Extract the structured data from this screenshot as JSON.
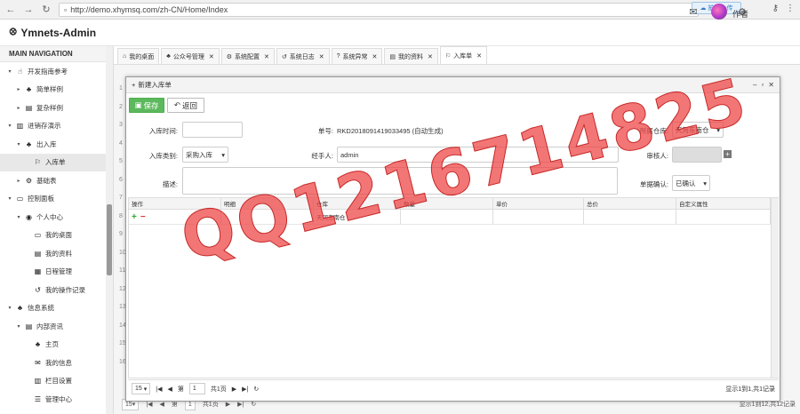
{
  "browser": {
    "url": "http://demo.xhymsq.com/zh-CN/Home/Index",
    "ext_label": "拍腾上传"
  },
  "header": {
    "app_title": "Ymnets-Admin",
    "username": "作者"
  },
  "sidebar": {
    "title": "MAIN NAVIGATION",
    "items": [
      {
        "label": "开发指南参考",
        "level": 0,
        "caret": "▾",
        "icon": "☝"
      },
      {
        "label": "简单样例",
        "level": 1,
        "caret": "▸",
        "icon": "♣"
      },
      {
        "label": "复杂样例",
        "level": 1,
        "caret": "▸",
        "icon": "▤"
      },
      {
        "label": "进销存演示",
        "level": 0,
        "caret": "▾",
        "icon": "▥"
      },
      {
        "label": "出入库",
        "level": 1,
        "caret": "▾",
        "icon": "♣"
      },
      {
        "label": "入库单",
        "level": 2,
        "caret": "",
        "icon": "⚐"
      },
      {
        "label": "基础表",
        "level": 1,
        "caret": "▸",
        "icon": "⚙"
      },
      {
        "label": "控制面板",
        "level": 0,
        "caret": "▾",
        "icon": "▭"
      },
      {
        "label": "个人中心",
        "level": 1,
        "caret": "▾",
        "icon": "◉"
      },
      {
        "label": "我的桌面",
        "level": 2,
        "caret": "",
        "icon": "▭"
      },
      {
        "label": "我的资料",
        "level": 2,
        "caret": "",
        "icon": "▤"
      },
      {
        "label": "日程管理",
        "level": 2,
        "caret": "",
        "icon": "▦"
      },
      {
        "label": "我的操作记录",
        "level": 2,
        "caret": "",
        "icon": "↺"
      },
      {
        "label": "信息系统",
        "level": 0,
        "caret": "▾",
        "icon": "♣"
      },
      {
        "label": "内部资讯",
        "level": 1,
        "caret": "▾",
        "icon": "▤"
      },
      {
        "label": "主页",
        "level": 2,
        "caret": "",
        "icon": "♣"
      },
      {
        "label": "我的信息",
        "level": 2,
        "caret": "",
        "icon": "✉"
      },
      {
        "label": "栏目设置",
        "level": 2,
        "caret": "",
        "icon": "▥"
      },
      {
        "label": "管理中心",
        "level": 2,
        "caret": "",
        "icon": "☰"
      }
    ]
  },
  "tabs": [
    {
      "label": "我的桌面",
      "icon": "⌂",
      "closable": false
    },
    {
      "label": "公众号管理",
      "icon": "♣",
      "closable": true
    },
    {
      "label": "系统配置",
      "icon": "⚙",
      "closable": true
    },
    {
      "label": "系统日志",
      "icon": "↺",
      "closable": true
    },
    {
      "label": "系统异常",
      "icon": "?",
      "closable": true
    },
    {
      "label": "我的资料",
      "icon": "▤",
      "closable": true
    },
    {
      "label": "入库单",
      "icon": "⚐",
      "closable": true,
      "active": true
    }
  ],
  "background": {
    "pager_size": "15",
    "page_label": "第",
    "page_value": "1",
    "page_total": "共1页",
    "summary": "显示1到12,共12记录"
  },
  "dialog": {
    "title": "新建入库单",
    "save_label": "保存",
    "back_label": "返回",
    "fields": {
      "date_label": "入库时间:",
      "date_value": "",
      "code_label": "单号:",
      "code_value": "RKD2018091419033495 (自动生成)",
      "warehouse_label": "所属仓库:",
      "warehouse_value": "天河东南仓",
      "type_label": "入库类别:",
      "type_value": "采购入库",
      "handler_label": "经手人:",
      "handler_value": "admin",
      "auditor_label": "审核人:",
      "auditor_value": "",
      "desc_label": "描述:",
      "desc_value": "",
      "confirm_label": "单据确认:",
      "confirm_value": "已确认"
    },
    "grid": {
      "columns": [
        "操作",
        "明细",
        "仓库",
        "数量",
        "单价",
        "总价",
        "自定义属性"
      ],
      "rows": [
        [
          "",
          "",
          "天河东南仓",
          "",
          "",
          "",
          ""
        ]
      ]
    },
    "pager": {
      "size": "15",
      "page_label": "第",
      "page_value": "1",
      "page_total": "共1页",
      "summary": "显示1到1,共1记录"
    }
  },
  "watermark": "QQ1216714825"
}
